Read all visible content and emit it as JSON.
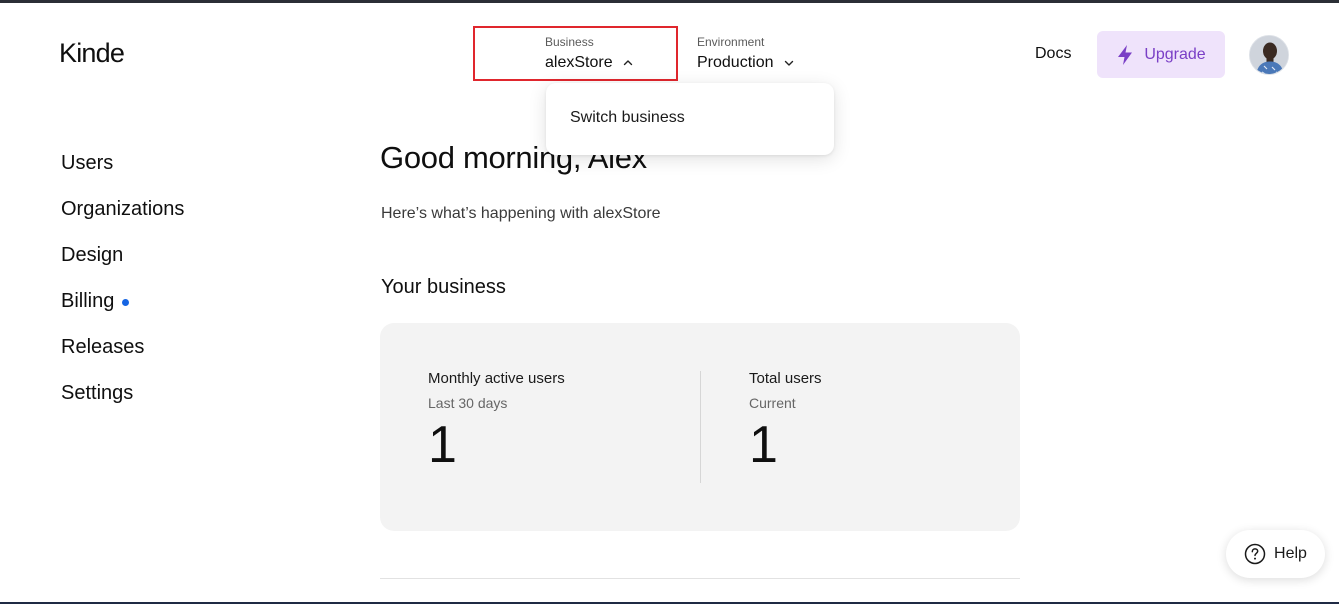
{
  "brand": {
    "logo_text": "Kinde"
  },
  "header": {
    "business": {
      "label": "Business",
      "value": "alexStore"
    },
    "environment": {
      "label": "Environment",
      "value": "Production"
    },
    "docs_label": "Docs",
    "upgrade_label": "Upgrade"
  },
  "business_menu": {
    "items": [
      "Switch business"
    ]
  },
  "sidebar": {
    "items": [
      {
        "label": "Users"
      },
      {
        "label": "Organizations"
      },
      {
        "label": "Design"
      },
      {
        "label": "Billing"
      },
      {
        "label": "Releases"
      },
      {
        "label": "Settings"
      }
    ]
  },
  "main": {
    "greeting": "Good morning, Alex",
    "subtext": "Here’s what’s happening with alexStore",
    "section_title": "Your business",
    "stats": [
      {
        "title": "Monthly active users",
        "subtitle": "Last 30 days",
        "value": "1"
      },
      {
        "title": "Total users",
        "subtitle": "Current",
        "value": "1"
      }
    ]
  },
  "help": {
    "label": "Help"
  },
  "colors": {
    "accent_purple": "#7a3fc6",
    "upgrade_bg": "#efe3fb",
    "highlight_red": "#e0262d",
    "billing_dot": "#1665e3",
    "card_bg": "#f3f3f3"
  },
  "icons": {
    "business_chevron": "chevron-up-icon",
    "environment_chevron": "chevron-down-icon",
    "upgrade": "lightning-icon",
    "help": "question-circle-icon"
  }
}
